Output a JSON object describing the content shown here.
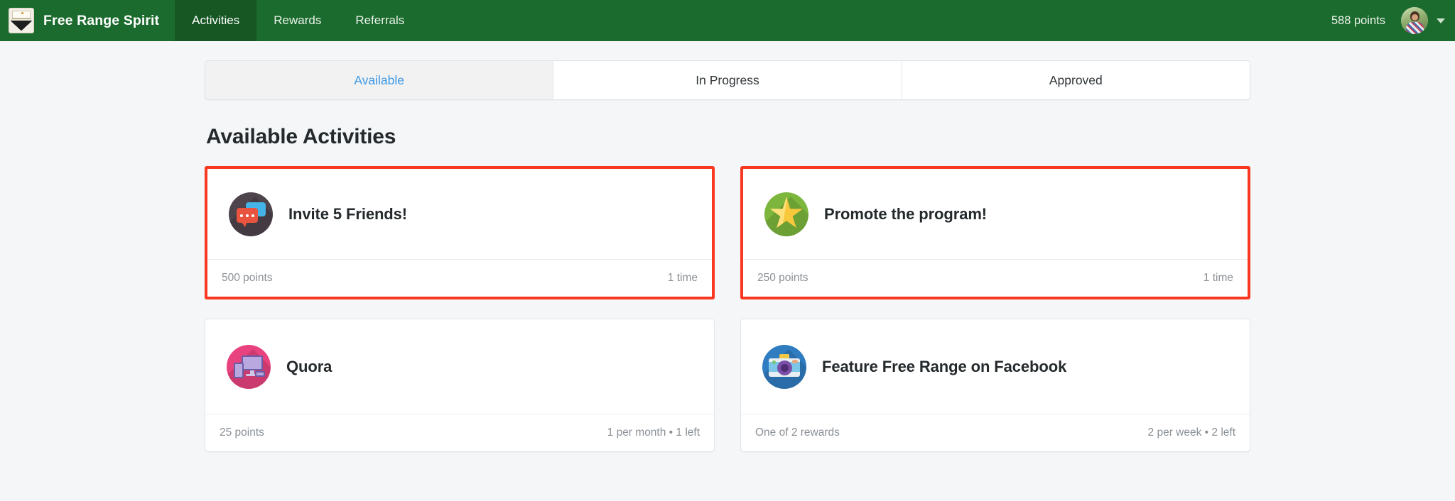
{
  "navbar": {
    "brand": "Free Range Spirit",
    "links": [
      {
        "label": "Activities",
        "active": true
      },
      {
        "label": "Rewards",
        "active": false
      },
      {
        "label": "Referrals",
        "active": false
      }
    ],
    "points": "588 points",
    "accent_color": "#1c6b2e",
    "active_link_color": "#175724"
  },
  "tabs": [
    {
      "label": "Available",
      "active": true
    },
    {
      "label": "In Progress",
      "active": false
    },
    {
      "label": "Approved",
      "active": false
    }
  ],
  "main": {
    "section_title": "Available Activities",
    "highlight_color": "#f93822",
    "cards": [
      {
        "title": "Invite 5 Friends!",
        "icon": "chat-bubbles-icon",
        "points": "500 points",
        "limit": "1 time",
        "highlighted": true
      },
      {
        "title": "Promote the program!",
        "icon": "star-icon",
        "points": "250 points",
        "limit": "1 time",
        "highlighted": true
      },
      {
        "title": "Quora",
        "icon": "devices-icon",
        "points": "25 points",
        "limit": "1 per month • 1 left",
        "highlighted": false
      },
      {
        "title": "Feature Free Range on Facebook",
        "icon": "camera-icon",
        "points": "One of 2 rewards",
        "limit": "2 per week • 2 left",
        "highlighted": false
      }
    ]
  }
}
